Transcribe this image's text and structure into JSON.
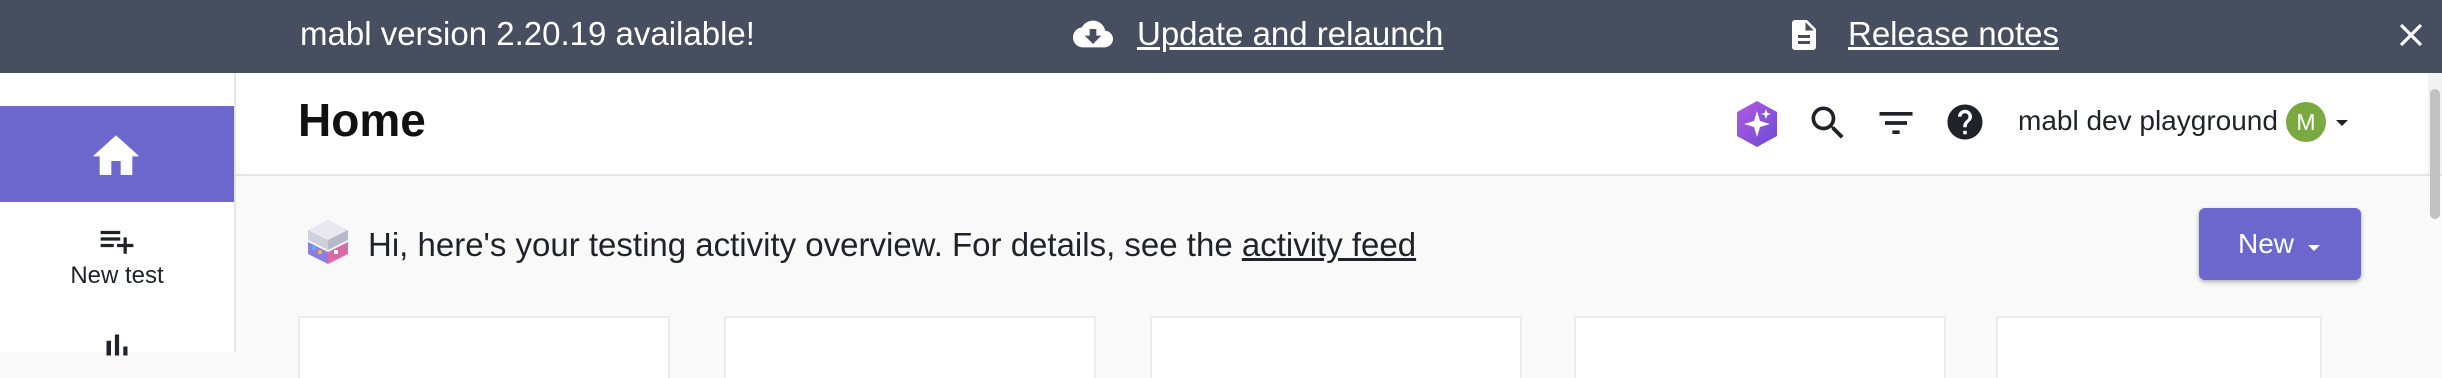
{
  "banner": {
    "message": "mabl version 2.20.19 available!",
    "update_label": "Update and relaunch",
    "release_notes_label": "Release notes",
    "icons": [
      "cloud-download-icon",
      "document-icon",
      "close-icon"
    ]
  },
  "sidebar": {
    "items": [
      {
        "label": "",
        "icon": "home-icon",
        "active": true
      },
      {
        "label": "New test",
        "icon": "playlist-add-icon"
      },
      {
        "label": "",
        "icon": "bar-chart-icon"
      }
    ],
    "accent_color": "#6b67cc"
  },
  "header": {
    "title": "Home",
    "icons": [
      "mabl-ai-icon",
      "search-icon",
      "filter-icon",
      "help-icon"
    ],
    "workspace": "mabl dev playground",
    "avatar_initial": "M",
    "avatar_color": "#7aa841"
  },
  "main": {
    "intro_prefix": "Hi, here's your testing activity overview. For details, see the",
    "intro_link": "activity feed",
    "new_button_label": "New"
  },
  "colors": {
    "banner_bg": "#474e60",
    "accent": "#6b67cc"
  }
}
